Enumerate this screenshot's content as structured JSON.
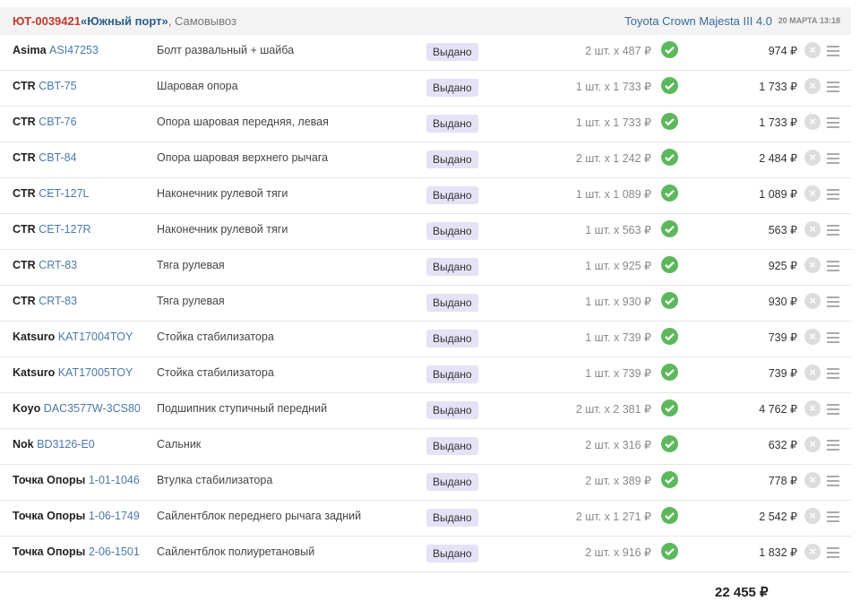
{
  "header": {
    "order": "ЮТ-0039421",
    "shop": "«Южный порт»",
    "delivery": ", Самовывоз",
    "car": "Toyota Crown Majesta III 4.0",
    "date": "20 МАРТА 13:18"
  },
  "items": [
    {
      "brand": "Asima",
      "code": "ASI47253",
      "desc": "Болт развальный + шайба",
      "status": "Выдано",
      "qty": "2 шт. x 487 ₽",
      "sum": "974 ₽"
    },
    {
      "brand": "CTR",
      "code": "CBT-75",
      "desc": "Шаровая опора",
      "status": "Выдано",
      "qty": "1 шт. x 1 733 ₽",
      "sum": "1 733 ₽"
    },
    {
      "brand": "CTR",
      "code": "CBT-76",
      "desc": "Опора шаровая передняя, левая",
      "status": "Выдано",
      "qty": "1 шт. x 1 733 ₽",
      "sum": "1 733 ₽"
    },
    {
      "brand": "CTR",
      "code": "CBT-84",
      "desc": "Опора шаровая верхнего рычага",
      "status": "Выдано",
      "qty": "2 шт. x 1 242 ₽",
      "sum": "2 484 ₽"
    },
    {
      "brand": "CTR",
      "code": "CET-127L",
      "desc": "Наконечник рулевой тяги",
      "status": "Выдано",
      "qty": "1 шт. x 1 089 ₽",
      "sum": "1 089 ₽"
    },
    {
      "brand": "CTR",
      "code": "CET-127R",
      "desc": "Наконечник рулевой тяги",
      "status": "Выдано",
      "qty": "1 шт. x 563 ₽",
      "sum": "563 ₽"
    },
    {
      "brand": "CTR",
      "code": "CRT-83",
      "desc": "Тяга рулевая",
      "status": "Выдано",
      "qty": "1 шт. x 925 ₽",
      "sum": "925 ₽"
    },
    {
      "brand": "CTR",
      "code": "CRT-83",
      "desc": "Тяга рулевая",
      "status": "Выдано",
      "qty": "1 шт. x 930 ₽",
      "sum": "930 ₽"
    },
    {
      "brand": "Katsuro",
      "code": "KAT17004TOY",
      "desc": "Стойка стабилизатора",
      "status": "Выдано",
      "qty": "1 шт. x 739 ₽",
      "sum": "739 ₽"
    },
    {
      "brand": "Katsuro",
      "code": "KAT17005TOY",
      "desc": "Стойка стабилизатора",
      "status": "Выдано",
      "qty": "1 шт. x 739 ₽",
      "sum": "739 ₽"
    },
    {
      "brand": "Koyo",
      "code": "DAC3577W-3CS80",
      "desc": "Подшипник ступичный передний",
      "status": "Выдано",
      "qty": "2 шт. x 2 381 ₽",
      "sum": "4 762 ₽"
    },
    {
      "brand": "Nok",
      "code": "BD3126-E0",
      "desc": "Сальник",
      "status": "Выдано",
      "qty": "2 шт. x 316 ₽",
      "sum": "632 ₽"
    },
    {
      "brand": "Точка Опоры",
      "code": "1-01-1046",
      "desc": "Втулка стабилизатора",
      "status": "Выдано",
      "qty": "2 шт. x 389 ₽",
      "sum": "778 ₽"
    },
    {
      "brand": "Точка Опоры",
      "code": "1-06-1749",
      "desc": "Сайлентблок переднего рычага задний",
      "status": "Выдано",
      "qty": "2 шт. x 1 271 ₽",
      "sum": "2 542 ₽"
    },
    {
      "brand": "Точка Опоры",
      "code": "2-06-1501",
      "desc": "Сайлентблок полиуретановый",
      "status": "Выдано",
      "qty": "2 шт. x 916 ₽",
      "sum": "1 832 ₽"
    }
  ],
  "total": "22 455 ₽"
}
